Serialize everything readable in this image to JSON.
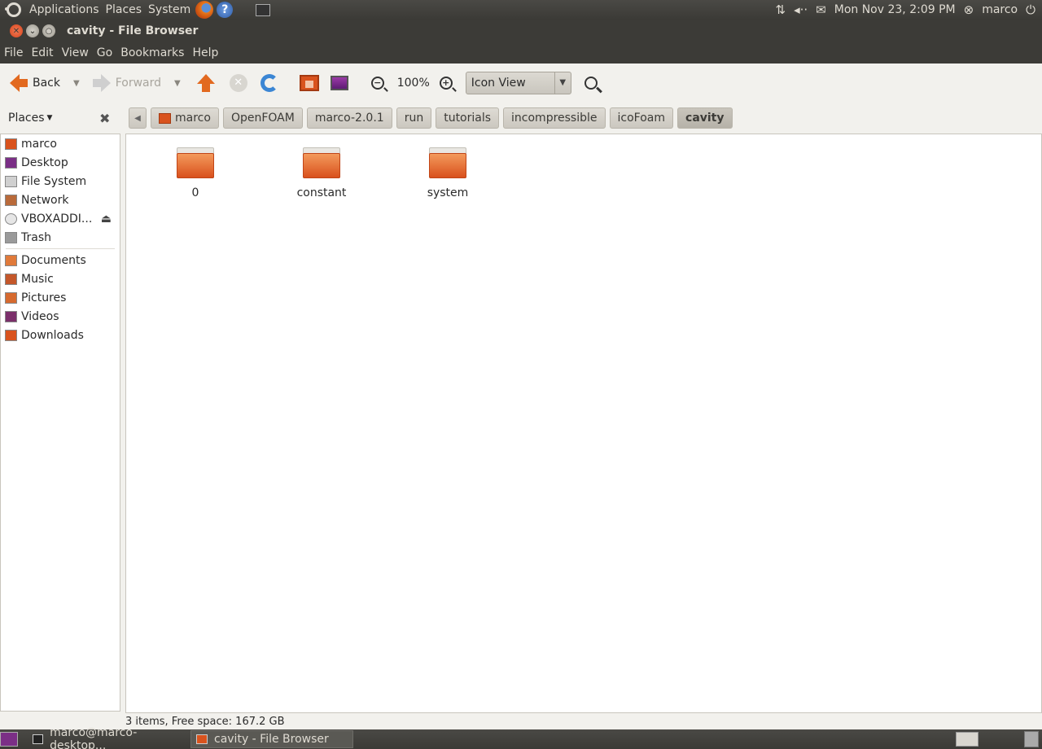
{
  "top_panel": {
    "menus": [
      "Applications",
      "Places",
      "System"
    ],
    "clock": "Mon Nov 23,  2:09 PM",
    "user": "marco"
  },
  "window": {
    "title": "cavity - File Browser"
  },
  "menubar": [
    "File",
    "Edit",
    "View",
    "Go",
    "Bookmarks",
    "Help"
  ],
  "toolbar": {
    "back_label": "Back",
    "forward_label": "Forward",
    "zoom_level": "100%",
    "view_mode": "Icon View"
  },
  "sidebar": {
    "header": "Places",
    "devices": [
      {
        "label": "marco",
        "icon": "home-folder-icon"
      },
      {
        "label": "Desktop",
        "icon": "desktop-icon"
      },
      {
        "label": "File System",
        "icon": "drive-icon"
      },
      {
        "label": "Network",
        "icon": "network-icon"
      },
      {
        "label": "VBOXADDI...",
        "icon": "cdrom-icon"
      },
      {
        "label": "Trash",
        "icon": "trash-icon"
      }
    ],
    "bookmarks": [
      {
        "label": "Documents",
        "icon": "documents-folder-icon"
      },
      {
        "label": "Music",
        "icon": "music-folder-icon"
      },
      {
        "label": "Pictures",
        "icon": "pictures-folder-icon"
      },
      {
        "label": "Videos",
        "icon": "videos-folder-icon"
      },
      {
        "label": "Downloads",
        "icon": "downloads-folder-icon"
      }
    ]
  },
  "pathbar": [
    "marco",
    "OpenFOAM",
    "marco-2.0.1",
    "run",
    "tutorials",
    "incompressible",
    "icoFoam",
    "cavity"
  ],
  "files": [
    {
      "name": "0",
      "icon": "folder-icon"
    },
    {
      "name": "constant",
      "icon": "folder-icon"
    },
    {
      "name": "system",
      "icon": "folder-icon"
    }
  ],
  "status": "3 items, Free space: 167.2 GB",
  "taskbar": {
    "tasks": [
      "marco@marco-desktop...",
      "cavity - File Browser"
    ]
  },
  "colors": {
    "panel": "#3c3b37",
    "accent": "#e2691f",
    "background": "#f2f1ed"
  }
}
